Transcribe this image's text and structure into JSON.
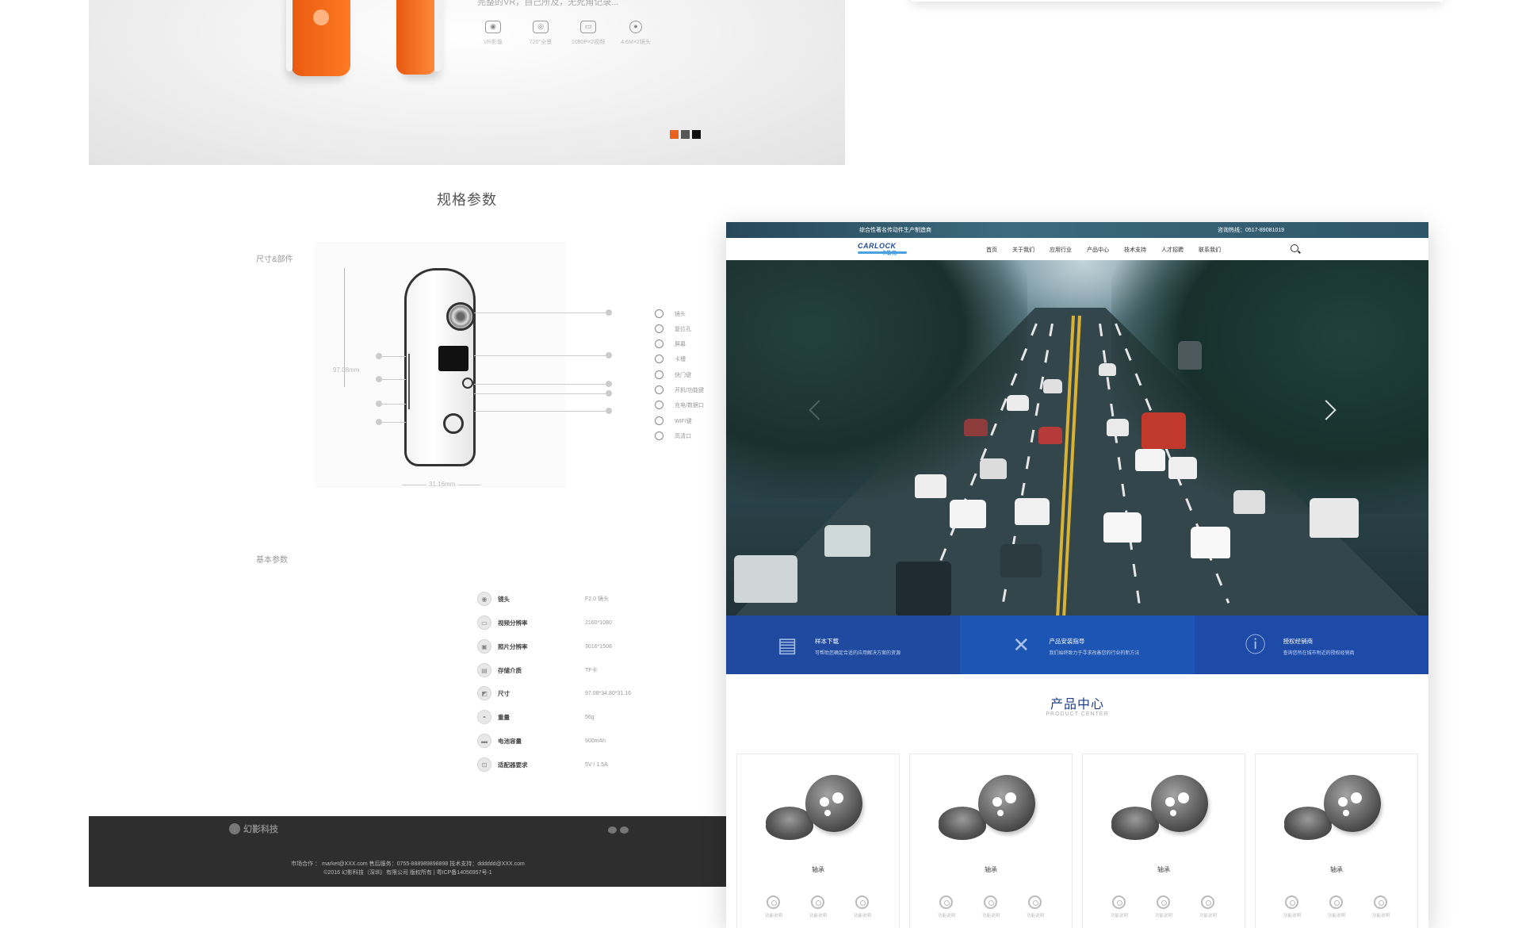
{
  "left_page": {
    "hero": {
      "tagline": "完整的VR，自己所及，无死角记录...",
      "features": [
        {
          "icon": "vr-headset-icon",
          "label": "VR影像"
        },
        {
          "icon": "panorama-icon",
          "label": "720°全景"
        },
        {
          "icon": "video-camera-icon",
          "label": "1080P×2视频"
        },
        {
          "icon": "lens-icon",
          "label": "4.6M×2镜头"
        }
      ],
      "carousel_colors": [
        "#e8641e",
        "#555555",
        "#111111"
      ]
    },
    "spec_title": "规格参数",
    "dimensions_label": "尺寸&部件",
    "diagram": {
      "height_label": "97.08mm",
      "width_label": "31.16mm",
      "parts": [
        "镜头",
        "复位孔",
        "屏幕",
        "卡槽",
        "快门键",
        "开机/功能键",
        "充电/数据口",
        "WIFI键",
        "高清口"
      ]
    },
    "basic_params_label": "基本参数",
    "params": [
      {
        "icon": "lens-icon",
        "name": "镜头",
        "value": "F2.0 镜头"
      },
      {
        "icon": "video-icon",
        "name": "视频分辨率",
        "value": "2160*1080"
      },
      {
        "icon": "photo-icon",
        "name": "照片分辨率",
        "value": "3016*1508"
      },
      {
        "icon": "storage-icon",
        "name": "存储介质",
        "value": "TF卡"
      },
      {
        "icon": "ruler-icon",
        "name": "尺寸",
        "value": "97.08*34.80*31.16"
      },
      {
        "icon": "weight-icon",
        "name": "重量",
        "value": "56g"
      },
      {
        "icon": "battery-icon",
        "name": "电池容量",
        "value": "900mAh"
      },
      {
        "icon": "adapter-icon",
        "name": "适配器要求",
        "value": "5V / 1.5A"
      }
    ],
    "footer": {
      "logo_text": "幻影科技",
      "contact_line": "市场合作 ： market@XXX.com        售后服务：0755-888989898898        技术支持：dddddd@XXX.com",
      "copyright_line": "©2016 幻影科技（深圳）有限公司 版权所有 | 粤ICP备14056957号-1"
    }
  },
  "site": {
    "topbar": {
      "slogan": "综合性著名传动件生产制造商",
      "hotline": "咨询热线：0517-89081019"
    },
    "logo": {
      "text": "CARLOCK",
      "sub": "卡勒克"
    },
    "nav": [
      "首页",
      "关于我们",
      "应用行业",
      "产品中心",
      "技术支持",
      "人才招聘",
      "联系我们"
    ],
    "features": [
      {
        "icon": "document-icon",
        "title": "样本下载",
        "desc": "可帮助您确定合适的应用解决方案的资源"
      },
      {
        "icon": "tools-icon",
        "title": "产品安装指导",
        "desc": "我们始终致力于寻求改善您的行业的新方法"
      },
      {
        "icon": "dealer-icon",
        "title": "授权经销商",
        "desc": "查询您所在城市附近的授权经销商"
      }
    ],
    "product_center": {
      "title": "产品中心",
      "subtitle": "PRODUCT CENTER",
      "products": [
        {
          "name": "轴承",
          "actions": [
            "功能说明",
            "功能说明",
            "功能说明"
          ]
        },
        {
          "name": "轴承",
          "actions": [
            "功能说明",
            "功能说明",
            "功能说明"
          ]
        },
        {
          "name": "轴承",
          "actions": [
            "功能说明",
            "功能说明",
            "功能说明"
          ]
        },
        {
          "name": "轴承",
          "actions": [
            "功能说明",
            "功能说明",
            "功能说明"
          ]
        }
      ]
    },
    "colors": {
      "brand_blue": "#1f4aa0",
      "topbar": "#2f5568",
      "accent_orange": "#e8641e"
    }
  }
}
